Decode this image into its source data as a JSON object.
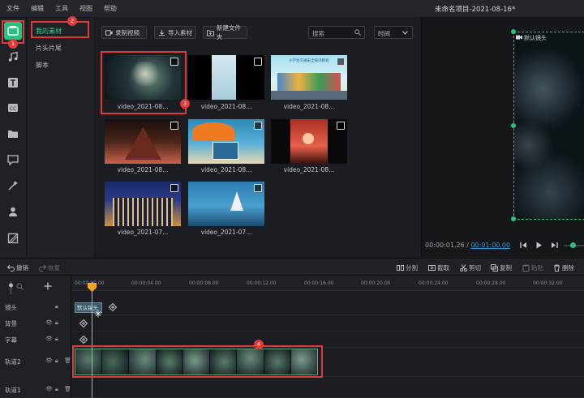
{
  "menu": [
    "文件",
    "编辑",
    "工具",
    "视图",
    "帮助"
  ],
  "project_title": "未命名项目-2021-08-16*",
  "categories": [
    "我的素材",
    "片头片尾",
    "脚本"
  ],
  "toolbar": {
    "record_label": "录制视频",
    "import_label": "导入素材",
    "newfolder_label": "新建文件夹",
    "search_placeholder": "搜索",
    "sort_label": "时间"
  },
  "media": [
    {
      "label": "video_2021-08..."
    },
    {
      "label": "video_2021-08..."
    },
    {
      "label": "video_2021-08...",
      "poster_text": "小学生交通安全知识教育"
    },
    {
      "label": "video_2021-08..."
    },
    {
      "label": "video_2021-08..."
    },
    {
      "label": "video_2021-08..."
    },
    {
      "label": "video_2021-07..."
    },
    {
      "label": "video_2021-07..."
    }
  ],
  "preview": {
    "lens_label": "默认镜头",
    "current_time": "00:00:01.26",
    "separator": "/",
    "duration": "00:01:00.00"
  },
  "edit_toolbar": {
    "undo": "撤销",
    "redo": "恢复",
    "split": "分割",
    "crop": "截取",
    "cut": "剪切",
    "copy": "复制",
    "paste": "粘贴",
    "delete": "删除"
  },
  "ruler_ticks": [
    "00:00:00.00",
    "00:00:04.00",
    "00:00:08.00",
    "00:00:12.00",
    "00:00:16.00",
    "00:00:20.00",
    "00:00:24.00",
    "00:00:28.00",
    "00:00:32.00"
  ],
  "tracks": [
    "镜头",
    "背景",
    "字幕",
    "轨道2",
    "轨道1"
  ],
  "lens_clip_label": "默认镜头",
  "badges": [
    "1",
    "2",
    "3",
    "4"
  ],
  "colors": {
    "accent": "#22c47f",
    "highlight": "#e03a3a",
    "playhead": "#f5a623",
    "link": "#29a0e0"
  }
}
